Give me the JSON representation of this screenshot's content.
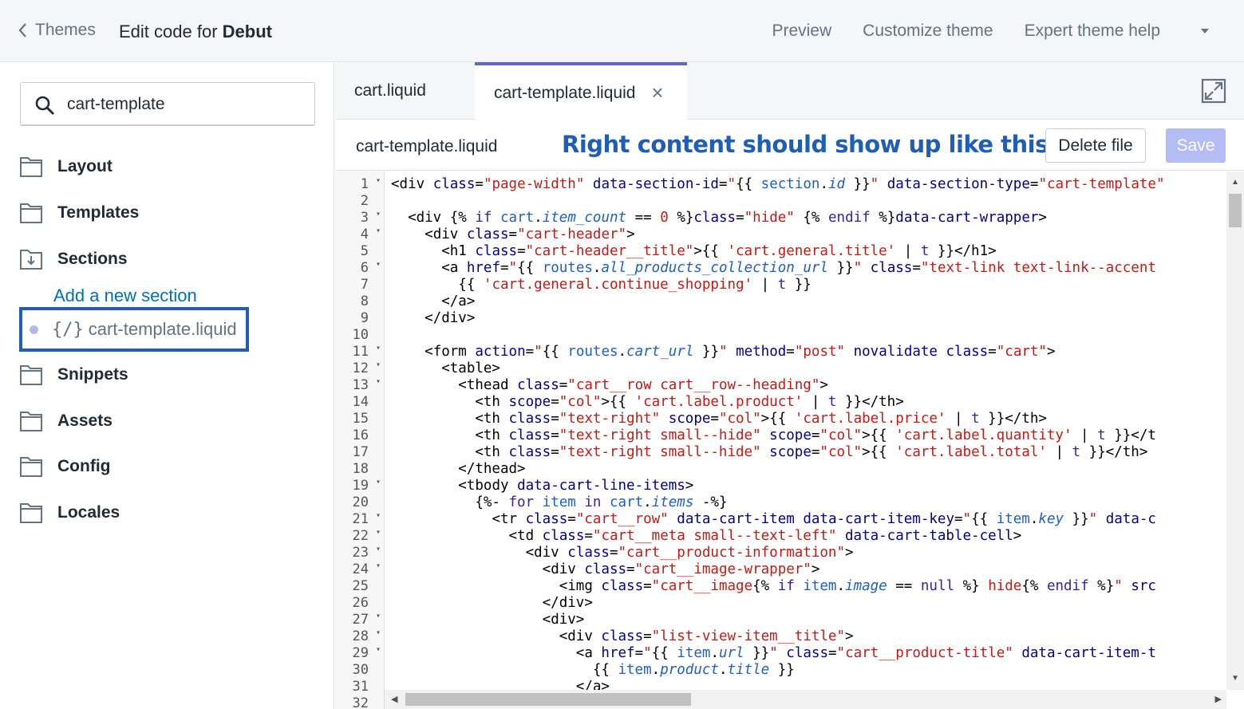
{
  "topbar": {
    "back_label": "Themes",
    "title_prefix": "Edit code for ",
    "title_theme": "Debut",
    "nav": {
      "preview": "Preview",
      "customize": "Customize theme",
      "help": "Expert theme help"
    }
  },
  "sidebar": {
    "search_value": "cart-template",
    "folders": [
      "Layout",
      "Templates",
      "Sections",
      "Snippets",
      "Assets",
      "Config",
      "Locales"
    ],
    "add_section": "Add a new section",
    "file_code_icon": "{/}",
    "file_name": "cart-template.liquid"
  },
  "tabs": {
    "tab1": "cart.liquid",
    "tab2": "cart-template.liquid",
    "close": "×"
  },
  "filehead": {
    "filename": "cart-template.liquid",
    "annotation": "Right content should show up like this",
    "delete_label": "Delete file",
    "save_label": "Save"
  },
  "editor": {
    "line_numbers": [
      "1",
      "2",
      "3",
      "4",
      "5",
      "6",
      "7",
      "8",
      "9",
      "10",
      "11",
      "12",
      "13",
      "14",
      "15",
      "16",
      "17",
      "18",
      "19",
      "20",
      "21",
      "22",
      "23",
      "24",
      "25",
      "26",
      "27",
      "28",
      "29",
      "30",
      "31",
      "32"
    ],
    "fold_lines": [
      1,
      3,
      4,
      6,
      11,
      12,
      13,
      19,
      21,
      22,
      23,
      24,
      27,
      28,
      29
    ]
  },
  "colors": {
    "accent": "#5c6ac4",
    "annotation": "#1e5eb8",
    "save_bg": "#b3bcf5",
    "link": "#006fbb"
  },
  "icons": [
    "chevron-left-icon",
    "search-icon",
    "folder-icon",
    "folder-download-icon",
    "close-icon",
    "expand-icon",
    "caret-down-icon"
  ]
}
